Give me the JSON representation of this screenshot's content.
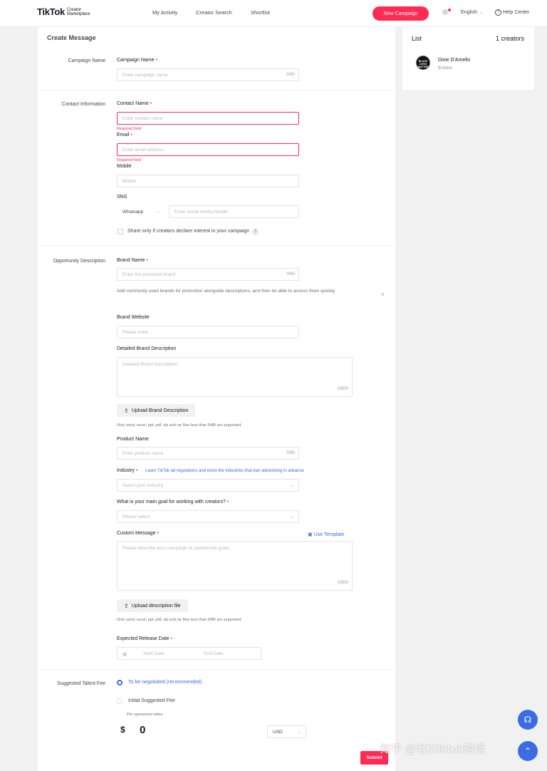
{
  "nav": {
    "logo_main": "TikTok",
    "logo_sub": "Creator Marketplace",
    "links": [
      "My Activity",
      "Creator Search",
      "Shortlist"
    ],
    "new_campaign": "New Campaign",
    "language": "English",
    "help": "Help Center"
  },
  "form": {
    "title": "Create Message",
    "sections": {
      "campaign": "Campaign Name",
      "contact": "Contact Information",
      "opportunity": "Opportunity Description",
      "fee": "Suggested Talent Fee"
    },
    "campaign_name": {
      "label": "Campaign Name",
      "placeholder": "Enter campaign name",
      "counter": "0/60"
    },
    "contact_name": {
      "label": "Contact Name",
      "placeholder": "Enter contact name",
      "error": "Required field"
    },
    "email": {
      "label": "Email",
      "placeholder": "Enter email address",
      "error": "Required field"
    },
    "mobile": {
      "label": "Mobile",
      "placeholder": "Mobile"
    },
    "sns": {
      "label": "SNS",
      "select_value": "Whatsapp",
      "placeholder": "Enter social media handle"
    },
    "share_checkbox": "Share only if creators declare interest in your campaign",
    "brand_name": {
      "label": "Brand Name",
      "placeholder": "Enter the promoted brand",
      "counter": "0/60"
    },
    "brand_info": "Add commonly used brands for promotion alongside descriptions, and then be able to access them quickly.",
    "brand_website": {
      "label": "Brand Website",
      "placeholder": "Please enter"
    },
    "brand_description": {
      "label": "Detailed Brand Description",
      "placeholder": "Detailed Brand Description",
      "counter": "0/800"
    },
    "upload_brand": "Upload Brand Description",
    "upload_hint": "Only word, excel, ppt, pdf, zip and rar files less than 5MB are supported.",
    "product_name": {
      "label": "Product Name",
      "placeholder": "Enter product name",
      "counter": "0/60"
    },
    "industry": {
      "label": "Industry",
      "link": "Learn TikTok ad regulations and know the industries that ban advertising in advance",
      "placeholder": "Select your industry"
    },
    "goal": {
      "label": "What is your main goal for working with creators?",
      "placeholder": "Please select"
    },
    "custom_message": {
      "label": "Custom Message",
      "template": "Use Template",
      "placeholder": "Please describe your campaign or partnership goals",
      "counter": "0/800"
    },
    "upload_desc": "Upload description file",
    "release_date": {
      "label": "Expected Release Date",
      "start": "Start Date",
      "end": "End Date"
    },
    "fee_negotiated": "To be negotiated (recommended)",
    "fee_initial": "Initial Suggested Fee",
    "per_video": "Per sponsored video",
    "currency_symbol": "$",
    "fee_value": "0",
    "currency": "USD",
    "submit": "Submit"
  },
  "sidebar": {
    "title": "List",
    "count": "1 creators",
    "creator": {
      "name": "Dixie D'Amello",
      "location": "Encino",
      "avatar_text": "BLACK LIVES MATTER"
    }
  },
  "watermark": "知乎 @老Ktiktok跨境"
}
